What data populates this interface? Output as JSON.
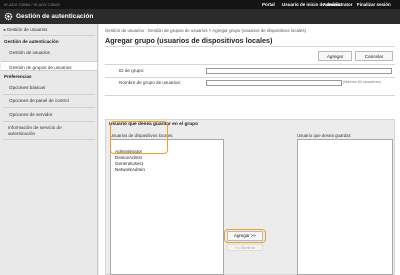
{
  "header": {
    "device_info": "iR-ADV C5560 / iR-ADV C5560",
    "portal": "Portal",
    "user_label": "Usuario de inicio de sesión:",
    "user_name": "Administrator",
    "logout": "Finalizar sesión"
  },
  "app": {
    "title": "Gestión de autenticación"
  },
  "sidebar": {
    "back_link": "Gestión de usuarios",
    "section1": "Gestión de autenticación",
    "items1": [
      "Gestión de usuarios",
      "Gestión de grupos de usuarios"
    ],
    "section2": "Preferencias",
    "items2": [
      "Opciones básicas",
      "Opciones de panel de control",
      "Opciones de servidor"
    ],
    "item3_line1": "Información de servicio de",
    "item3_line2": "autenticación"
  },
  "page": {
    "breadcrumb": "Gestión de usuarios : Gestión de grupos de usuarios > Agregar grupo (usuarios de dispositivos locales)",
    "title": "Agregar grupo (usuarios de dispositivos locales)",
    "add_button": "Agregar",
    "cancel_button": "Cancelar",
    "group_id_label": "ID de grupo:",
    "group_name_label": "Nombre de grupo de usuarios:",
    "group_name_hint": "(Máximo 64 caracteres)",
    "group_id_value": "",
    "group_name_value": ""
  },
  "members": {
    "section_title": "Usuario que desea guardar en el grupo",
    "local_users_label": "Usuarios de dispositivos locales:",
    "save_users_label": "Usuario que desea guardar:",
    "local_users": [
      "Administrator",
      "DeviceAdmin",
      "GeneralUser1",
      "NetworkAdmin"
    ],
    "saved_users": [],
    "add_arrow_button": "Agregar >>",
    "remove_button": "<< Eliminar"
  },
  "colors": {
    "highlight": "#f0a020",
    "topbar": "#141414",
    "titlebar": "#2b2b2b"
  }
}
